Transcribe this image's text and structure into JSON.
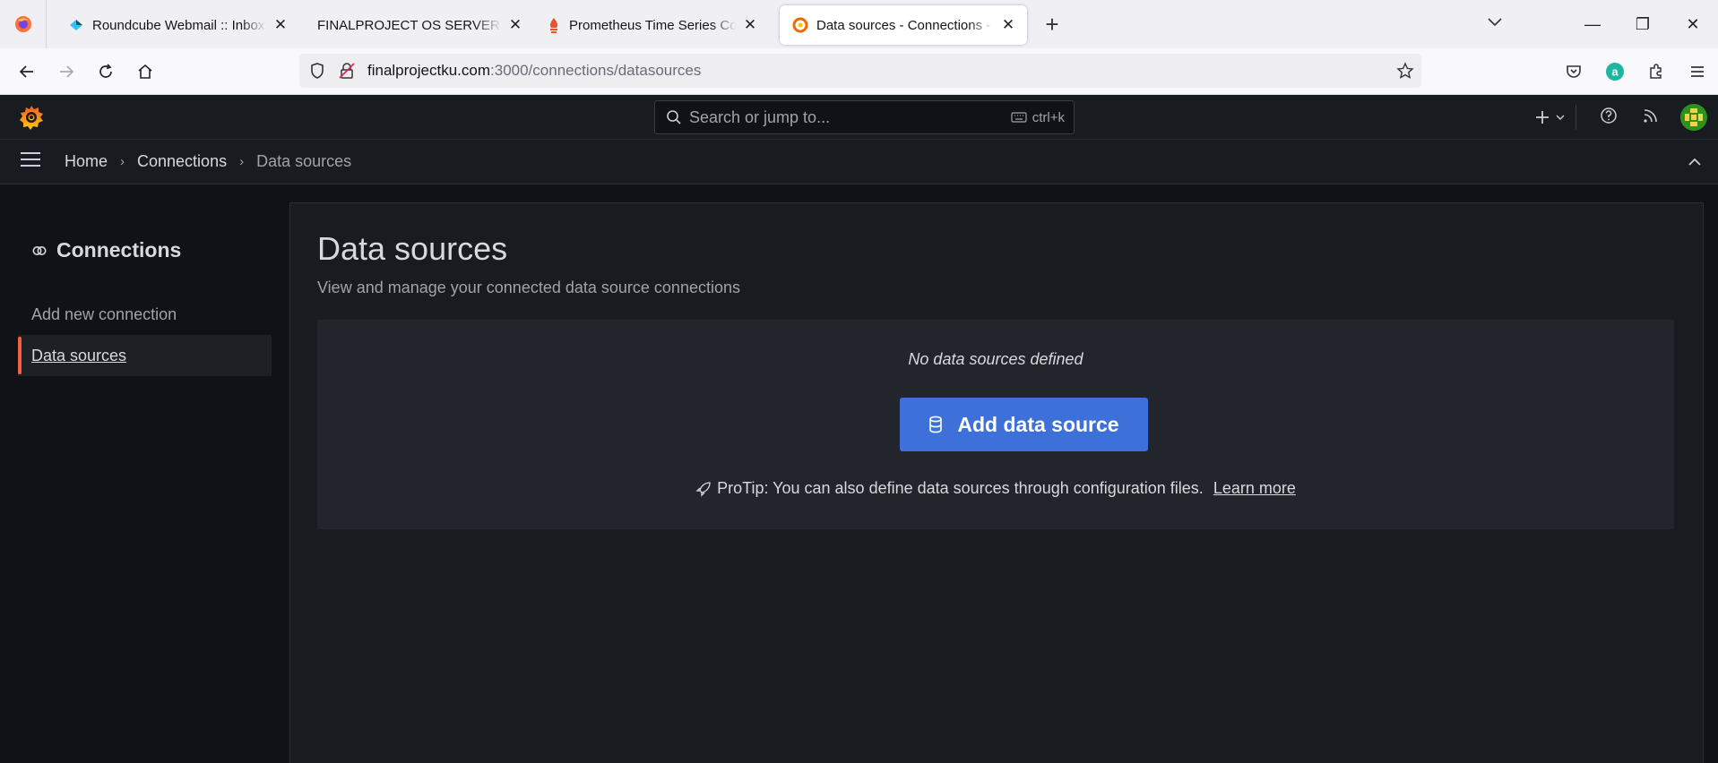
{
  "browser": {
    "tabs": [
      {
        "title": "Roundcube Webmail :: Inbox",
        "active": false
      },
      {
        "title": "FINALPROJECT OS SERVER & SYSADMIN",
        "active": false
      },
      {
        "title": "Prometheus Time Series Collection",
        "active": false
      },
      {
        "title": "Data sources - Connections - Grafana",
        "active": true
      }
    ],
    "url_host": "finalprojectku.com",
    "url_path": ":3000/connections/datasources"
  },
  "grafana": {
    "search_placeholder": "Search or jump to...",
    "search_shortcut": "ctrl+k",
    "breadcrumb": {
      "home": "Home",
      "connections": "Connections",
      "current": "Data sources"
    }
  },
  "sidebar": {
    "title": "Connections",
    "items": [
      {
        "label": "Add new connection",
        "active": false
      },
      {
        "label": "Data sources",
        "active": true
      }
    ]
  },
  "main": {
    "title": "Data sources",
    "subtitle": "View and manage your connected data source connections",
    "empty_message": "No data sources defined",
    "add_button": "Add data source",
    "protip": "ProTip: You can also define data sources through configuration files.",
    "learn_more": "Learn more"
  },
  "colors": {
    "accent": "#f55f3e",
    "primary_button": "#3d71d9",
    "background": "#111217",
    "panel": "#181b1f"
  }
}
